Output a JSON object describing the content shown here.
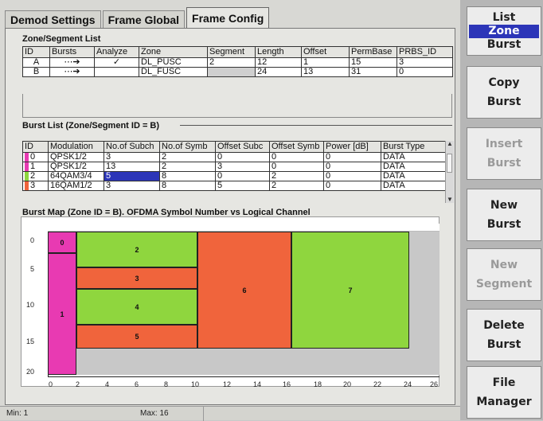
{
  "tabs": [
    "Demod Settings",
    "Frame Global",
    "Frame Config"
  ],
  "zone_list": {
    "title": "Zone/Segment List",
    "headers": [
      "ID",
      "Bursts",
      "Analyze",
      "Zone",
      "Segment",
      "Length",
      "Offset",
      "PermBase",
      "PRBS_ID"
    ],
    "rows": [
      {
        "id": "A",
        "bursts": "⋯➔",
        "analyze": "✓",
        "zone": "DL_PUSC",
        "segment": "2",
        "length": "12",
        "offset": "1",
        "permbase": "15",
        "prbs": "3"
      },
      {
        "id": "B",
        "bursts": "⋯➔",
        "analyze": "",
        "zone": "DL_FUSC",
        "segment": "",
        "length": "24",
        "offset": "13",
        "permbase": "31",
        "prbs": "0"
      }
    ]
  },
  "burst_list": {
    "title": "Burst List (Zone/Segment ID = B)",
    "headers": [
      "ID",
      "Modulation",
      "No.of Subch",
      "No.of Symb",
      "Offset Subc",
      "Offset Symb",
      "Power [dB]",
      "Burst Type"
    ],
    "rows": [
      {
        "id": "0",
        "color": "#e83ab2",
        "mod": "QPSK1/2",
        "nsub": "3",
        "nsym": "2",
        "osub": "0",
        "osym": "0",
        "pwr": "0",
        "type": "DATA"
      },
      {
        "id": "1",
        "color": "#e83ab2",
        "mod": "QPSK1/2",
        "nsub": "13",
        "nsym": "2",
        "osub": "3",
        "osym": "0",
        "pwr": "0",
        "type": "DATA"
      },
      {
        "id": "2",
        "color": "#8fd63e",
        "mod": "64QAM3/4",
        "nsub": "5",
        "nsym": "8",
        "osub": "0",
        "osym": "2",
        "pwr": "0",
        "type": "DATA"
      },
      {
        "id": "3",
        "color": "#f0643c",
        "mod": "16QAM1/2",
        "nsub": "3",
        "nsym": "8",
        "osub": "5",
        "osym": "2",
        "pwr": "0",
        "type": "DATA"
      }
    ]
  },
  "burst_map": {
    "title": "Burst Map (Zone ID = B). OFDMA Symbol Number vs Logical Channel",
    "x_ticks": [
      "0",
      "2",
      "4",
      "6",
      "8",
      "10",
      "12",
      "14",
      "16",
      "18",
      "20",
      "22",
      "24",
      "26"
    ],
    "y_ticks": [
      "0",
      "5",
      "10",
      "15",
      "20"
    ],
    "blocks": [
      {
        "label": "0",
        "color": "#e83ab2"
      },
      {
        "label": "1",
        "color": "#e83ab2"
      },
      {
        "label": "2",
        "color": "#8fd63e"
      },
      {
        "label": "3",
        "color": "#f0643c"
      },
      {
        "label": "4",
        "color": "#8fd63e"
      },
      {
        "label": "5",
        "color": "#f0643c"
      },
      {
        "label": "6",
        "color": "#f0643c"
      },
      {
        "label": "7",
        "color": "#8fd63e"
      }
    ]
  },
  "status": {
    "min": "Min: 1",
    "max": "Max: 16"
  },
  "softkeys": {
    "list": {
      "top": "List",
      "selected": "Zone",
      "bottom": "Burst"
    },
    "copy": [
      "Copy",
      "Burst"
    ],
    "insert": [
      "Insert",
      "Burst"
    ],
    "new_burst": [
      "New",
      "Burst"
    ],
    "new_segment": [
      "New",
      "Segment"
    ],
    "delete": [
      "Delete",
      "Burst"
    ],
    "file": [
      "File",
      "Manager"
    ]
  },
  "colors": {
    "selection": "#2c35b8",
    "magenta": "#e83ab2",
    "green": "#8fd63e",
    "orange": "#f0643c"
  }
}
